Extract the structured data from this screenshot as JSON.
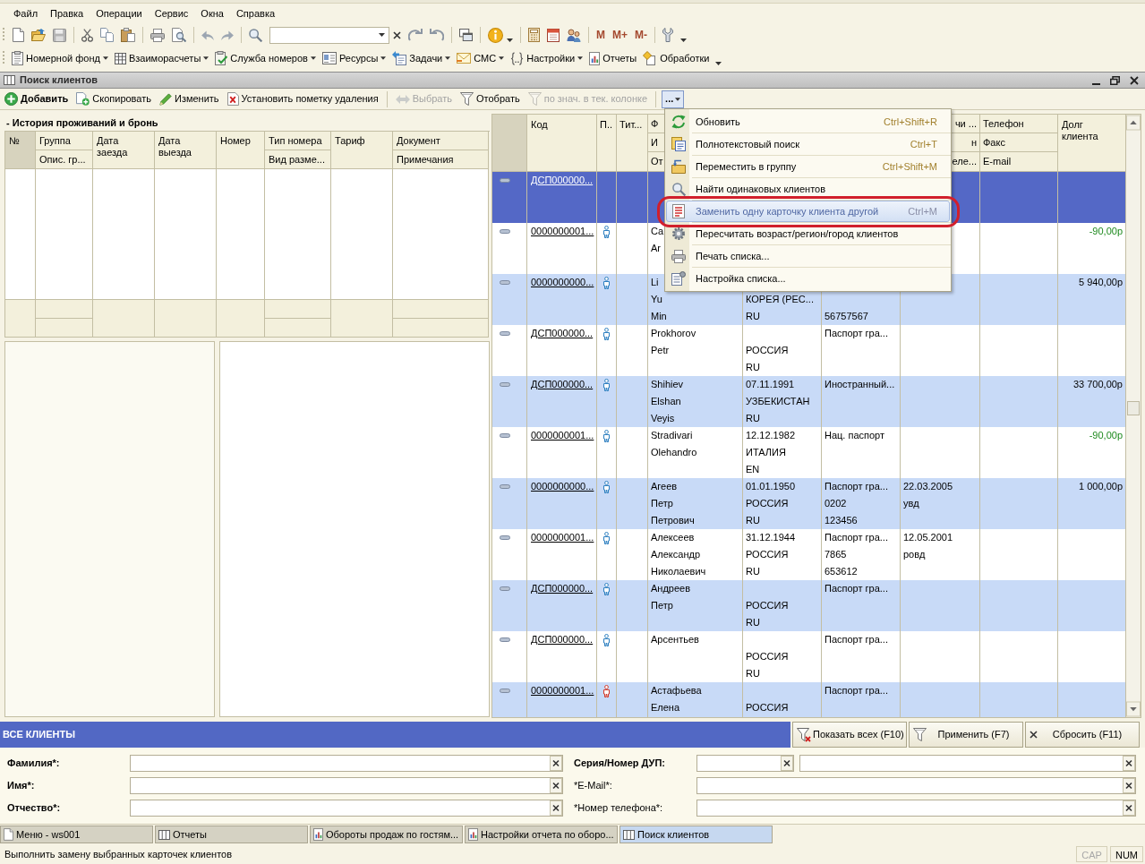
{
  "menu_bar": [
    "Файл",
    "Правка",
    "Операции",
    "Сервис",
    "Окна",
    "Справка"
  ],
  "main_toolbar": {
    "memory_buttons": [
      "M",
      "M+",
      "M-"
    ]
  },
  "sections_toolbar": [
    {
      "label": "Номерной фонд",
      "has_menu": true
    },
    {
      "label": "Взаиморасчеты",
      "has_menu": true
    },
    {
      "label": "Служба номеров",
      "has_menu": true
    },
    {
      "label": "Ресурсы",
      "has_menu": true
    },
    {
      "label": "Задачи",
      "has_menu": true
    },
    {
      "label": "СМС",
      "has_menu": true
    },
    {
      "label": "Настройки",
      "has_menu": true
    },
    {
      "label": "Отчеты",
      "has_menu": false
    },
    {
      "label": "Обработки",
      "has_menu": false
    }
  ],
  "window": {
    "title": "Поиск клиентов"
  },
  "command_bar": {
    "groups": [
      [
        {
          "label": "Добавить",
          "bold": true,
          "disabled": false
        },
        {
          "label": "Скопировать",
          "bold": false,
          "disabled": false
        },
        {
          "label": "Изменить",
          "bold": false,
          "disabled": false
        },
        {
          "label": "Установить пометку удаления",
          "bold": false,
          "disabled": false
        }
      ],
      [
        {
          "label": "Выбрать",
          "bold": false,
          "disabled": true
        },
        {
          "label": "Отобрать",
          "bold": false,
          "disabled": false
        },
        {
          "label": "по знач. в тек. колонке",
          "bold": false,
          "disabled": true
        }
      ]
    ],
    "more_button": {
      "label": "...",
      "pressed": true
    }
  },
  "more_menu": {
    "items": [
      {
        "label": "Обновить",
        "shortcut": "Ctrl+Shift+R",
        "selected": false,
        "circled": false
      },
      {
        "label": "Полнотекстовый поиск",
        "shortcut": "Ctrl+T",
        "selected": false,
        "circled": false
      },
      {
        "label": "Переместить в группу",
        "shortcut": "Ctrl+Shift+M",
        "selected": false,
        "circled": false
      },
      {
        "label": "Найти одинаковых клиентов",
        "selected": false,
        "circled": false
      },
      {
        "label": "Заменить одну карточку клиента другой",
        "shortcut": "Ctrl+M",
        "selected": true,
        "circled": true
      },
      {
        "label": "Пересчитать возраст/регион/город клиентов",
        "selected": false,
        "circled": false
      },
      {
        "label": "Печать списка...",
        "selected": false,
        "circled": false
      },
      {
        "label": "Настройка списка...",
        "selected": false,
        "circled": false
      }
    ]
  },
  "history_panel": {
    "title": "- История проживаний и бронь",
    "columns": [
      {
        "label": "№"
      },
      {
        "label": "Группа",
        "sub": "Опис. гр..."
      },
      {
        "label": "Дата заезда"
      },
      {
        "label": "Дата выезда"
      },
      {
        "label": "Номер"
      },
      {
        "label": "Тип номера",
        "sub": "Вид разме..."
      },
      {
        "label": "Тариф"
      },
      {
        "label": "Документ",
        "sub": "Примечания"
      }
    ]
  },
  "clients_table": {
    "header": {
      "code": "Код",
      "column_3": "П..",
      "column_4": "Тит...",
      "column_5": [
        "Ф",
        "И",
        "От"
      ],
      "column_8": [
        "чи ...",
        "н",
        "еле..."
      ],
      "contacts": [
        "Телефон",
        "Факс",
        "E-mail"
      ],
      "debt": "Долг клиента"
    },
    "rows": [
      {
        "selected": true,
        "code": "ДСП000000..."
      },
      {
        "selected": false,
        "code": "0000000001...",
        "person_icon": {
          "color": "#2d7fc0"
        },
        "column_5": {
          "line_1": "Ca",
          "line_2": "Ar"
        },
        "debt": {
          "text": "-90,00р",
          "color": "#1e8a1e"
        }
      },
      {
        "selected": false,
        "code": "0000000000...",
        "person_icon": {
          "color": "#2d7fc0"
        },
        "column_5": {
          "line_1": "Li",
          "line_2": "Yu",
          "line_3": "Min"
        },
        "column_6": {
          "line_2": "КОРЕЯ (РЕС...",
          "line_3": "RU"
        },
        "column_7": {
          "line_3": "56757567"
        },
        "debt": {
          "text": "5 940,00р"
        }
      },
      {
        "selected": false,
        "code": "ДСП000000...",
        "person_icon": {
          "color": "#2d7fc0"
        },
        "column_5": {
          "line_1": "Prokhorov",
          "line_2": "Petr"
        },
        "column_6": {
          "line_2": "РОССИЯ",
          "line_3": "RU"
        },
        "column_7": {
          "line_1": "Паспорт гра..."
        }
      },
      {
        "selected": false,
        "code": "ДСП000000...",
        "person_icon": {
          "color": "#2d7fc0"
        },
        "column_5": {
          "line_1": "Shihiev",
          "line_2": "Elshan",
          "line_3": "Veyis"
        },
        "column_6": {
          "line_1": "07.11.1991",
          "line_2": "УЗБЕКИСТАН",
          "line_3": "RU"
        },
        "column_7": {
          "line_1": "Иностранный..."
        },
        "debt": {
          "text": "33 700,00р"
        }
      },
      {
        "selected": false,
        "code": "0000000001...",
        "person_icon": {
          "color": "#2d7fc0"
        },
        "column_5": {
          "line_1": "Stradivari",
          "line_2": "Olehandro"
        },
        "column_6": {
          "line_1": "12.12.1982",
          "line_2": "ИТАЛИЯ",
          "line_3": "EN"
        },
        "column_7": {
          "line_1": "Нац. паспорт"
        },
        "debt": {
          "text": "-90,00р",
          "color": "#1e8a1e"
        }
      },
      {
        "selected": false,
        "code": "0000000000...",
        "person_icon": {
          "color": "#2d7fc0"
        },
        "column_5": {
          "line_1": "Агеев",
          "line_2": "Петр",
          "line_3": "Петрович"
        },
        "column_6": {
          "line_1": "01.01.1950",
          "line_2": "РОССИЯ",
          "line_3": "RU"
        },
        "column_7": {
          "line_1": "Паспорт гра...",
          "line_2": "0202",
          "line_3": "123456"
        },
        "column_8": {
          "line_1": "22.03.2005",
          "line_2": "увд"
        },
        "debt": {
          "text": "1 000,00р"
        }
      },
      {
        "selected": false,
        "code": "0000000001...",
        "person_icon": {
          "color": "#2d7fc0"
        },
        "column_5": {
          "line_1": "Алексеев",
          "line_2": "Александр",
          "line_3": "Николаевич"
        },
        "column_6": {
          "line_1": "31.12.1944",
          "line_2": "РОССИЯ",
          "line_3": "RU"
        },
        "column_7": {
          "line_1": "Паспорт гра...",
          "line_2": "7865",
          "line_3": "653612"
        },
        "column_8": {
          "line_1": "12.05.2001",
          "line_2": "ровд"
        }
      },
      {
        "selected": false,
        "code": "ДСП000000...",
        "person_icon": {
          "color": "#2d7fc0"
        },
        "column_5": {
          "line_1": "Андреев",
          "line_2": "Петр"
        },
        "column_6": {
          "line_2": "РОССИЯ",
          "line_3": "RU"
        },
        "column_7": {
          "line_1": "Паспорт гра..."
        }
      },
      {
        "selected": false,
        "code": "ДСП000000...",
        "person_icon": {
          "color": "#2d7fc0"
        },
        "column_5": {
          "line_1": "Арсентьев"
        },
        "column_6": {
          "line_2": "РОССИЯ",
          "line_3": "RU"
        },
        "column_7": {
          "line_1": "Паспорт гра..."
        }
      },
      {
        "selected": false,
        "code": "0000000001...",
        "person_icon": {
          "color": "#d23a2a"
        },
        "column_5": {
          "line_1": "Астафьева",
          "line_2": "Елена"
        },
        "column_6": {
          "line_2": "РОССИЯ"
        },
        "column_7": {
          "line_1": "Паспорт гра..."
        }
      }
    ]
  },
  "filter_bar": {
    "title": "ВСЕ КЛИЕНТЫ",
    "buttons": [
      "Показать всех (F10)",
      "Применить (F7)",
      "Сбросить (F11)"
    ]
  },
  "filters": {
    "left": [
      {
        "label": "Фамилия*:",
        "bold": true,
        "inputs": [
          {
            "kind": "long"
          }
        ]
      },
      {
        "label": "Имя*:",
        "bold": true,
        "inputs": [
          {
            "kind": "long"
          }
        ]
      },
      {
        "label": "Отчество*:",
        "bold": true,
        "inputs": [
          {
            "kind": "long"
          }
        ]
      }
    ],
    "right": [
      {
        "label": "Серия/Номер ДУП:",
        "bold": true,
        "inputs": [
          {
            "kind": "short"
          },
          {
            "kind": "long"
          }
        ]
      },
      {
        "label": "*E-Mail*:",
        "bold": false,
        "inputs": [
          {
            "kind": "long"
          }
        ]
      },
      {
        "label": "*Номер телефона*:",
        "bold": false,
        "inputs": [
          {
            "kind": "long"
          }
        ]
      }
    ]
  },
  "taskbar": [
    {
      "label": "Меню - ws001",
      "kind": "menu",
      "selected": false
    },
    {
      "label": "Отчеты",
      "kind": "list",
      "selected": false
    },
    {
      "label": "Обороты продаж по гостям...",
      "kind": "report",
      "selected": false
    },
    {
      "label": "Настройки отчета по оборо...",
      "kind": "report",
      "selected": false
    },
    {
      "label": "Поиск клиентов",
      "kind": "list",
      "selected": true
    }
  ],
  "status_bar": {
    "message": "Выполнить замену выбранных карточек клиентов",
    "indicators": [
      {
        "label": "CAP",
        "on": false
      },
      {
        "label": "NUM",
        "on": true
      }
    ]
  }
}
